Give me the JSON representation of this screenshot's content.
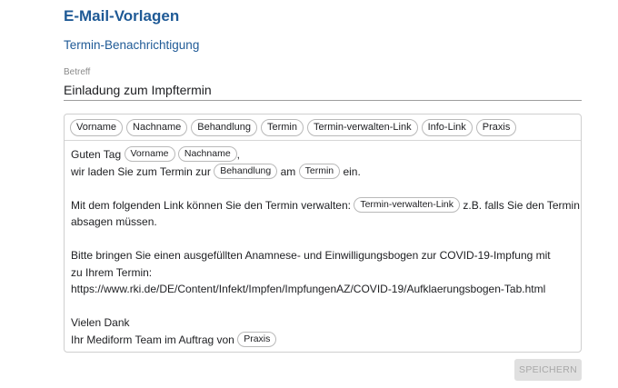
{
  "page": {
    "title": "E-Mail-Vorlagen",
    "section_title": "Termin-Benachrichtigung"
  },
  "subject": {
    "label": "Betreff",
    "value": "Einladung zum Impftermin"
  },
  "toolbar": {
    "chips": [
      "Vorname",
      "Nachname",
      "Behandlung",
      "Termin",
      "Termin-verwalten-Link",
      "Info-Link",
      "Praxis"
    ]
  },
  "body": {
    "greeting": "Guten Tag",
    "chip_vorname": "Vorname",
    "chip_nachname": "Nachname",
    "comma": ",",
    "line2_a": "wir laden Sie zum Termin zur",
    "chip_behandlung": "Behandlung",
    "line2_b": "am",
    "chip_termin": "Termin",
    "line2_c": "ein.",
    "line3_a": "Mit dem folgenden Link können Sie den Termin verwalten:",
    "chip_link": "Termin-verwalten-Link",
    "line3_b": "z.B. falls Sie den Termin",
    "line4": "absagen müssen.",
    "line5": "Bitte bringen Sie einen ausgefüllten Anamnese- und Einwilligungsbogen zur COVID-19-Impfung mit",
    "line6": "zu Ihrem Termin:",
    "line7": "https://www.rki.de/DE/Content/Infekt/Impfen/ImpfungenAZ/COVID-19/Aufklaerungsbogen-Tab.html",
    "line8": "Vielen Dank",
    "line9_a": "Ihr Mediform Team im Auftrag von",
    "chip_praxis": "Praxis"
  },
  "actions": {
    "save_label": "SPEICHERN"
  },
  "colors": {
    "title": "#1f5a96",
    "save_disabled_bg": "#e0e0e0",
    "save_disabled_text": "#a8a8a8"
  }
}
